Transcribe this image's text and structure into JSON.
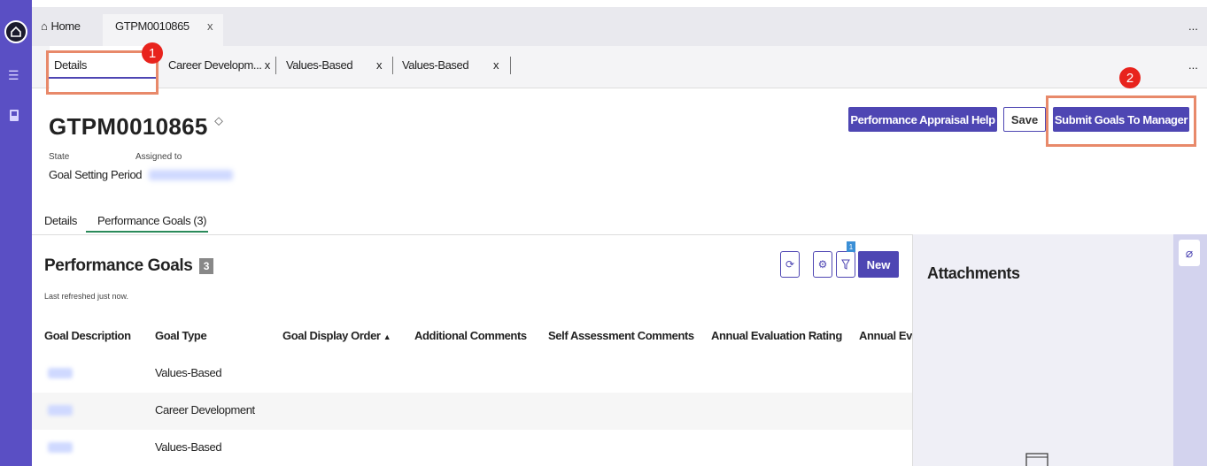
{
  "top_tabs": {
    "home": "Home",
    "record": "GTPM0010865",
    "close": "x",
    "more": "..."
  },
  "sub_tabs": [
    {
      "label": "Details",
      "close": ""
    },
    {
      "label": "Career Developm...",
      "close": "x"
    },
    {
      "label": "Values-Based",
      "close": "x"
    },
    {
      "label": "Values-Based",
      "close": "x"
    }
  ],
  "sub_more": "...",
  "annotations": {
    "one": "1",
    "two": "2"
  },
  "record": {
    "title": "GTPM0010865",
    "state_label": "State",
    "state_value": "Goal Setting Period",
    "assigned_label": "Assigned to"
  },
  "buttons": {
    "help": "Performance Appraisal Help",
    "save": "Save",
    "submit": "Submit Goals To Manager"
  },
  "form_tabs": {
    "details": "Details",
    "goals": "Performance Goals (3)"
  },
  "list": {
    "title": "Performance Goals",
    "count": "3",
    "refreshed": "Last refreshed just now.",
    "filter_count": "1",
    "new_label": "New",
    "columns": [
      "Goal Description",
      "Goal Type",
      "Goal Display Order",
      "Additional Comments",
      "Self Assessment Comments",
      "Annual Evaluation Rating",
      "Annual Eva"
    ],
    "sort_indicator": "▲",
    "rows": [
      {
        "type": "Values-Based"
      },
      {
        "type": "Career Development"
      },
      {
        "type": "Values-Based"
      }
    ]
  },
  "attachments": {
    "title": "Attachments"
  },
  "colors": {
    "accent": "#4e46b3",
    "rail": "#5a4fc4",
    "annotation": "#e8896a",
    "badge": "#e8231d"
  }
}
